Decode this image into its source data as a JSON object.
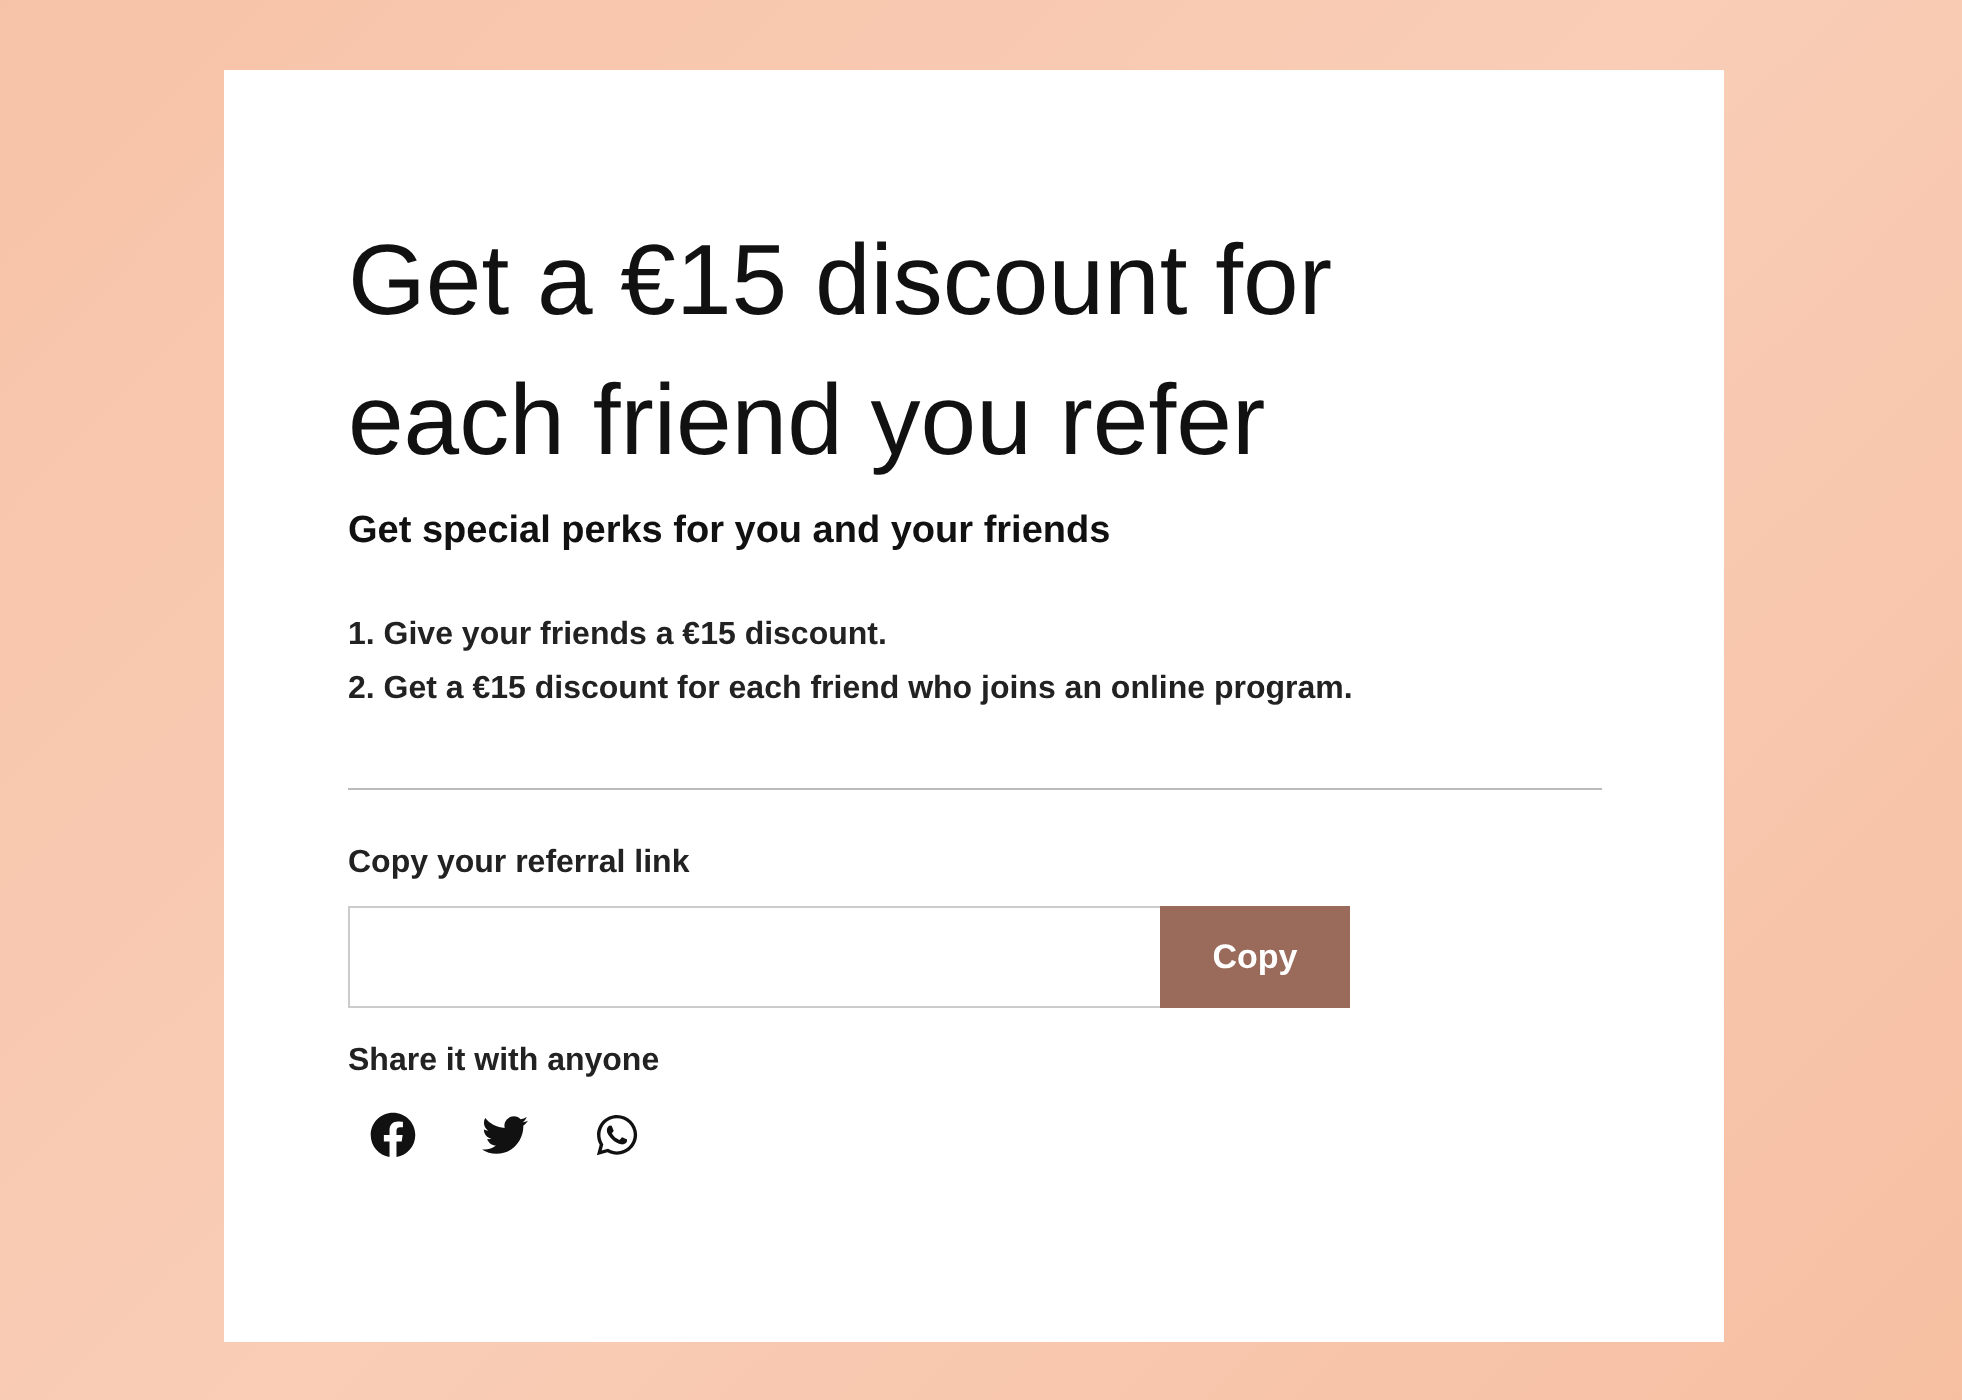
{
  "card": {
    "title": "Get a €15 discount for each friend you refer",
    "subtitle": "Get special perks for you and your friends",
    "steps": [
      "1. Give your friends a €15 discount.",
      "2. Get a €15 discount for each friend who joins an online program."
    ],
    "referral": {
      "label": "Copy your referral link",
      "button": "Copy"
    },
    "share": {
      "label": "Share it with anyone",
      "networks": [
        {
          "kind": "facebook"
        },
        {
          "kind": "twitter"
        },
        {
          "kind": "whatsapp"
        }
      ]
    }
  }
}
